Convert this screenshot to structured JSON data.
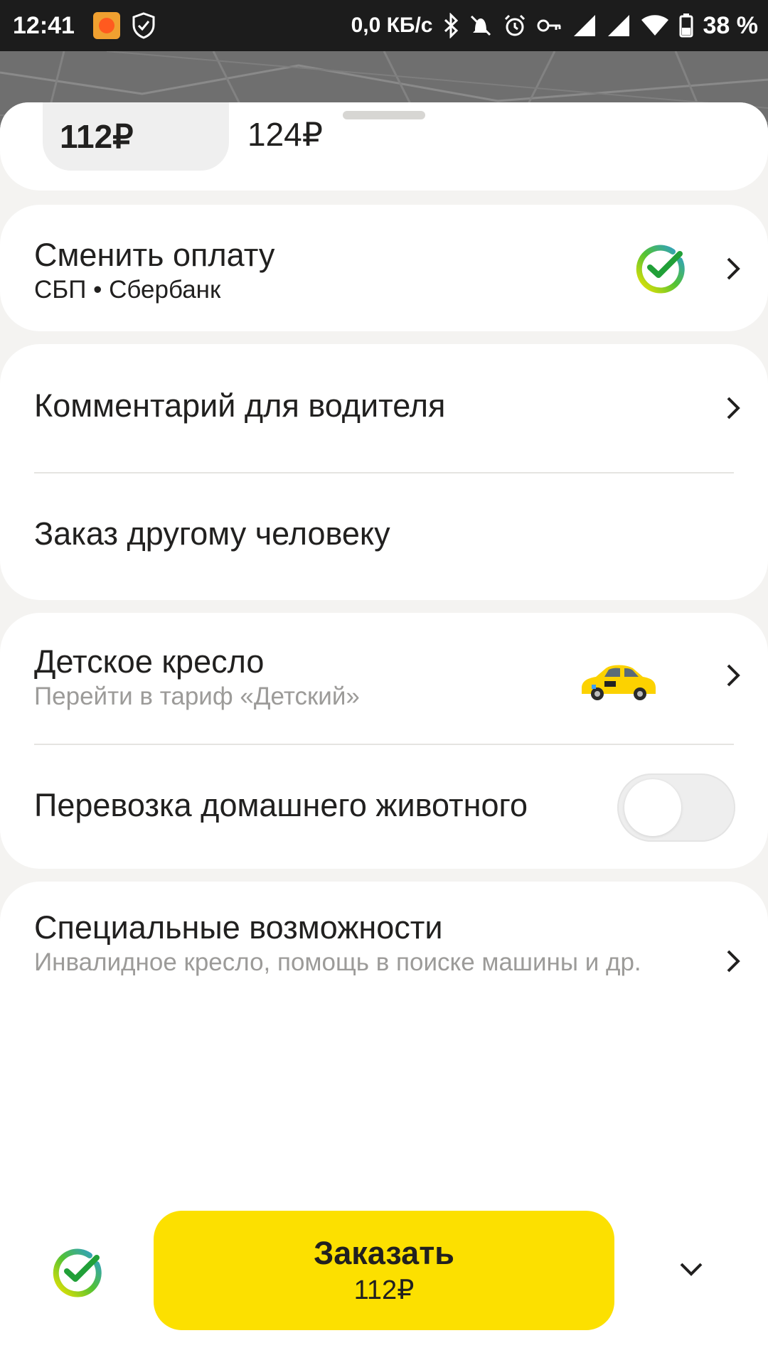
{
  "status_bar": {
    "time": "12:41",
    "network_speed": "0,0 КБ/с",
    "battery": "38 %",
    "icons": [
      "app-notification-icon",
      "shield-icon",
      "bluetooth-icon",
      "vibrate-icon",
      "alarm-icon",
      "key-icon",
      "signal-icon",
      "signal-icon",
      "wifi-icon",
      "battery-icon"
    ]
  },
  "fare": {
    "selected_price": "112₽",
    "other_price": "124₽"
  },
  "payment": {
    "title": "Сменить оплату",
    "method": "СБП • Сбербанк",
    "icon": "sberbank-logo-icon",
    "brand_color": "#21a038"
  },
  "options": [
    {
      "label": "Комментарий для водителя"
    },
    {
      "label": "Заказ другому человеку"
    }
  ],
  "child_seat": {
    "title": "Детское кресло",
    "subtitle": "Перейти в тариф «Детский»",
    "icon": "taxi-car-icon"
  },
  "pet": {
    "label": "Перевозка домашнего животного",
    "enabled": false
  },
  "accessibility": {
    "title": "Специальные возможности",
    "subtitle": "Инвалидное кресло, помощь в поиске машины и др."
  },
  "order_button": {
    "label": "Заказать",
    "price": "112₽",
    "color": "#fce000"
  }
}
